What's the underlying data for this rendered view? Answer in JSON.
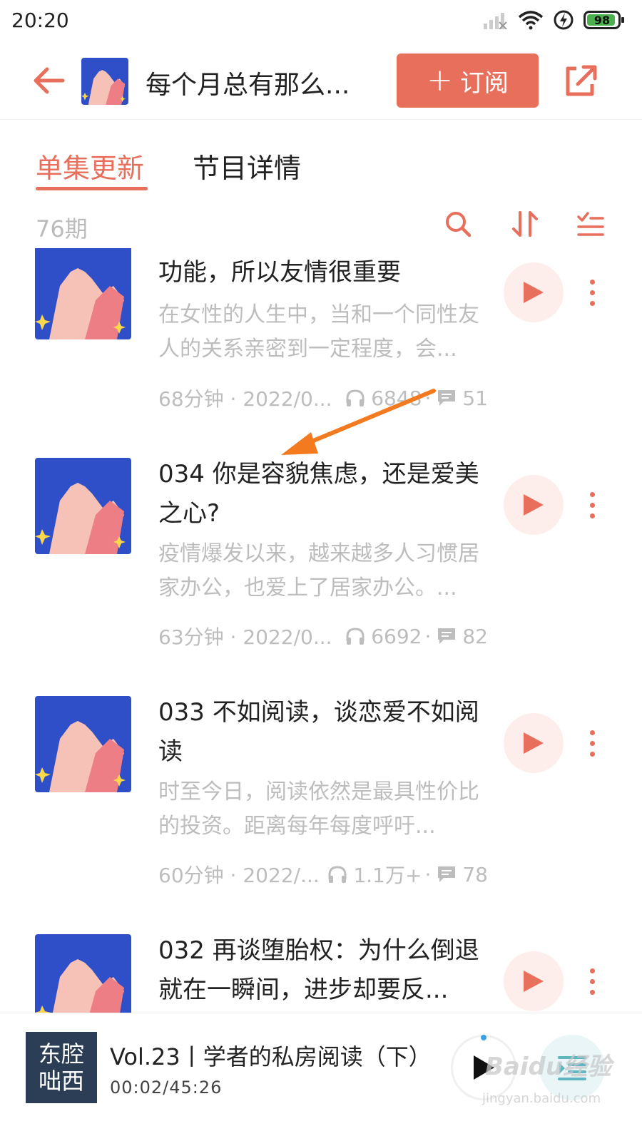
{
  "status_bar": {
    "time": "20:20",
    "battery": "98"
  },
  "header": {
    "title": "每个月总有那么...",
    "subscribe_label": "订阅"
  },
  "tabs": [
    {
      "label": "单集更新",
      "active": true
    },
    {
      "label": "节目详情",
      "active": false
    }
  ],
  "toolbar": {
    "count": "76期"
  },
  "episodes": [
    {
      "title": "功能，所以友情很重要",
      "desc": "在女性的人生中，当和一个同性友人的关系亲密到一定程度，会...",
      "duration_date": "68分钟 · 2022/0...",
      "plays": "6848",
      "comments": "51"
    },
    {
      "title": "034 你是容貌焦虑，还是爱美之心?",
      "desc": "疫情爆发以来，越来越多人习惯居家办公，也爱上了居家办公。...",
      "duration_date": "63分钟 · 2022/0...",
      "plays": "6692",
      "comments": "82"
    },
    {
      "title": "033 不如阅读，谈恋爱不如阅读",
      "desc": "时至今日，阅读依然是最具性价比的投资。距离每年每度呼吁...",
      "duration_date": "60分钟 · 2022/...",
      "plays": "1.1万+",
      "comments": "78"
    },
    {
      "title": "032 再谈堕胎权：为什么倒退就在一瞬间，进步却要反...",
      "desc": "",
      "duration_date": "",
      "plays": "",
      "comments": ""
    }
  ],
  "player": {
    "cover_line1": "东腔",
    "cover_line2": "咄西",
    "title": "Vol.23丨学者的私房阅读（下）",
    "time": "00:02/45:26"
  },
  "watermark": {
    "text": "Baidu经验",
    "sub": "jingyan.baidu.com"
  },
  "colors": {
    "accent": "#e86f5c",
    "play_bg": "#fdeeeb",
    "cover_blue": "#2f4fc8"
  }
}
